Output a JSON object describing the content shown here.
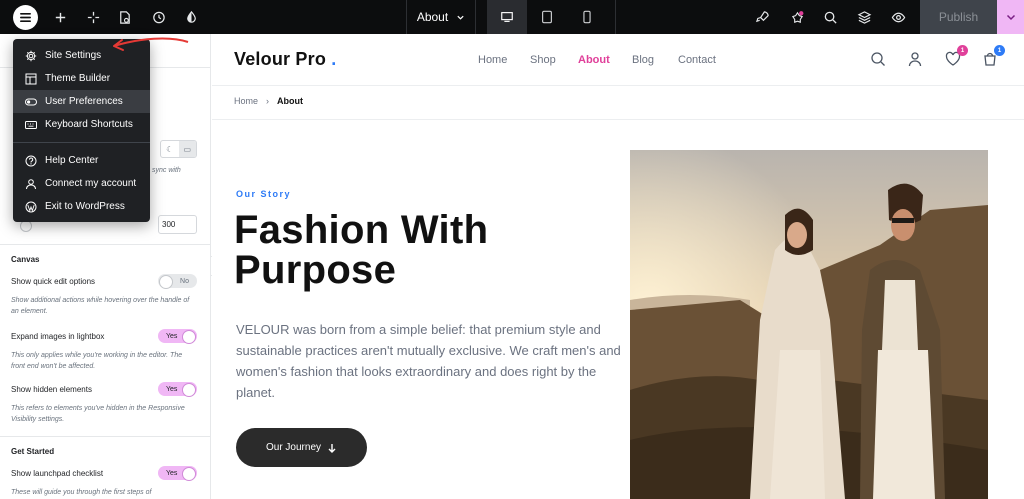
{
  "topbar": {
    "page_name": "About",
    "publish_label": "Publish",
    "icons": [
      "menu-icon",
      "plus-icon",
      "sparkle-icon",
      "page-settings-icon",
      "history-icon",
      "contrast-icon",
      "rocket-icon",
      "notifications-icon",
      "search-icon",
      "layers-icon",
      "preview-icon"
    ]
  },
  "menu": {
    "items": [
      {
        "label": "Site Settings",
        "icon": "gear-icon"
      },
      {
        "label": "Theme Builder",
        "icon": "theme-builder-icon"
      },
      {
        "label": "User Preferences",
        "icon": "toggle-icon"
      },
      {
        "label": "Keyboard Shortcuts",
        "icon": "keyboard-icon"
      },
      {
        "label": "Help Center",
        "icon": "help-icon"
      },
      {
        "label": "Connect my account",
        "icon": "user-icon"
      },
      {
        "label": "Exit to WordPress",
        "icon": "wordpress-icon"
      }
    ]
  },
  "panel": {
    "sync_text_peek": "sync with",
    "width_value": "300",
    "canvas_title": "Canvas",
    "quick_edit_label": "Show quick edit options",
    "quick_edit_toggle": "No",
    "quick_edit_desc": "Show additional actions while hovering over the handle of an element.",
    "lightbox_label": "Expand images in lightbox",
    "lightbox_toggle": "Yes",
    "lightbox_desc": "This only applies while you're working in the editor. The front end won't be affected.",
    "hidden_label": "Show hidden elements",
    "hidden_toggle": "Yes",
    "hidden_desc": "This refers to elements you've hidden in the Responsive Visibility settings.",
    "get_started_title": "Get Started",
    "launchpad_label": "Show launchpad checklist",
    "launchpad_toggle": "Yes",
    "launchpad_desc": "These will guide you through the first steps of"
  },
  "site": {
    "logo": "Velour Pro",
    "logo_dot": ".",
    "nav": [
      "Home",
      "Shop",
      "About",
      "Blog",
      "Contact"
    ],
    "active_nav": "About",
    "wishlist_count": "1",
    "cart_count": "1",
    "breadcrumb_home": "Home",
    "breadcrumb_sep": "›",
    "breadcrumb_current": "About",
    "eyebrow": "Our Story",
    "headline": "Fashion With Purpose",
    "body": "VELOUR was born from a simple belief: that premium style and sustainable practices aren't mutually exclusive. We craft men's and women's fashion that looks extraordinary and does right by the planet.",
    "cta_label": "Our Journey"
  },
  "colors": {
    "accent_pink": "#e0409a",
    "accent_blue": "#2e7bf6",
    "toggle_on": "#f0b7f5",
    "topbar_bg": "#0c0d0e",
    "arrow_red": "#e53935"
  }
}
